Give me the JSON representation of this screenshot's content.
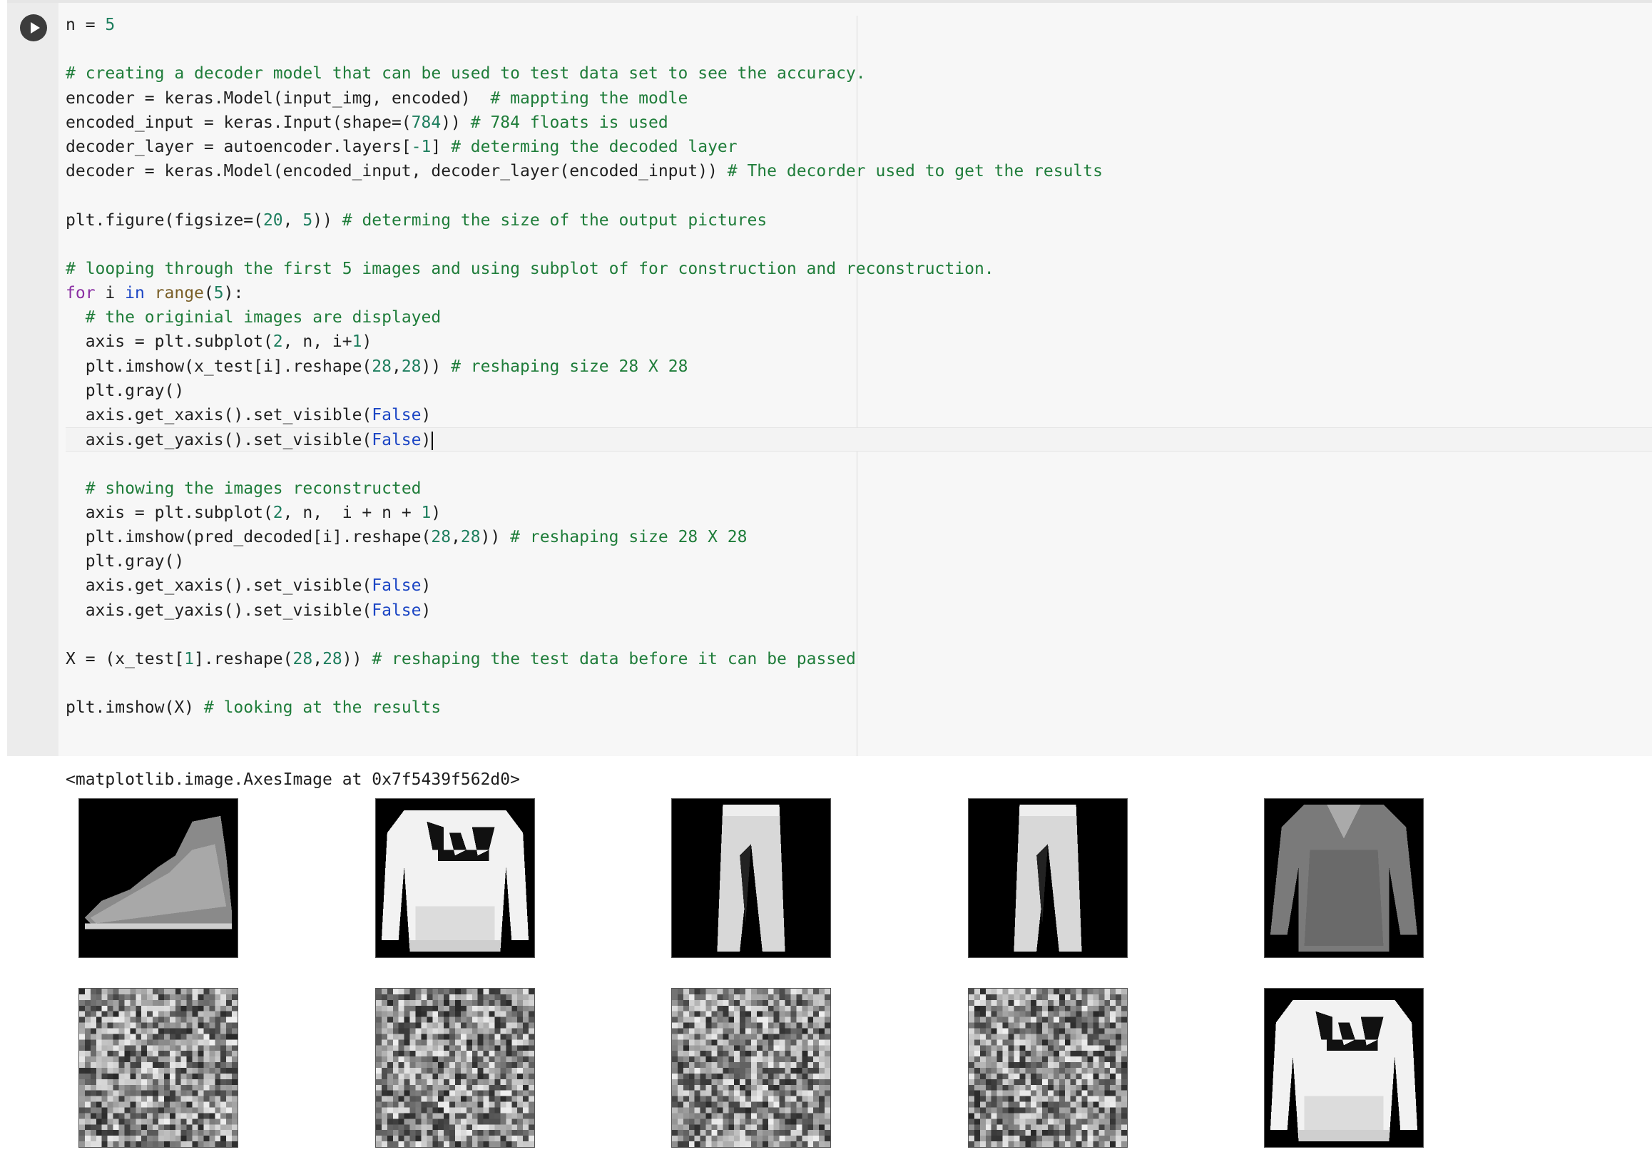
{
  "cell": {
    "run_button_label": "Run cell",
    "lines": [
      [
        [
          "n = ",
          ""
        ],
        [
          "5",
          "t-num"
        ]
      ],
      [],
      [
        [
          "# creating a decoder model that can be used to test data set to see the accuracy.",
          "t-com"
        ]
      ],
      [
        [
          "encoder = keras.Model(input_img, encoded)  ",
          ""
        ],
        [
          "# mappting the modle",
          "t-com"
        ]
      ],
      [
        [
          "encoded_input = keras.Input(shape=(",
          ""
        ],
        [
          "784",
          "t-num"
        ],
        [
          ")) ",
          ""
        ],
        [
          "# 784 floats is used",
          "t-com"
        ]
      ],
      [
        [
          "decoder_layer = autoencoder.layers[",
          ""
        ],
        [
          "-1",
          "t-num"
        ],
        [
          "] ",
          ""
        ],
        [
          "# determing the decoded layer",
          "t-com"
        ]
      ],
      [
        [
          "decoder = keras.Model(encoded_input, decoder_layer(encoded_input)) ",
          ""
        ],
        [
          "# The decorder used to get the results",
          "t-com"
        ]
      ],
      [],
      [
        [
          "plt.figure(figsize=(",
          ""
        ],
        [
          "20",
          "t-num"
        ],
        [
          ", ",
          ""
        ],
        [
          "5",
          "t-num"
        ],
        [
          ")) ",
          ""
        ],
        [
          "# determing the size of the output pictures",
          "t-com"
        ]
      ],
      [],
      [
        [
          "# looping through the first 5 images and using subplot of for construction and reconstruction.",
          "t-com"
        ]
      ],
      [
        [
          "for",
          "t-kw"
        ],
        [
          " i ",
          ""
        ],
        [
          "in",
          "t-kw2"
        ],
        [
          " ",
          ""
        ],
        [
          "range",
          "t-bi"
        ],
        [
          "(",
          ""
        ],
        [
          "5",
          "t-num"
        ],
        [
          "):",
          ""
        ]
      ],
      [
        [
          "  ",
          ""
        ],
        [
          "# the originial images are displayed",
          "t-com"
        ]
      ],
      [
        [
          "  axis = plt.subplot(",
          ""
        ],
        [
          "2",
          "t-num"
        ],
        [
          ", n, i+",
          ""
        ],
        [
          "1",
          "t-num"
        ],
        [
          ")",
          ""
        ]
      ],
      [
        [
          "  plt.imshow(x_test[i].reshape(",
          ""
        ],
        [
          "28",
          "t-num"
        ],
        [
          ",",
          ""
        ],
        [
          "28",
          "t-num"
        ],
        [
          ")) ",
          ""
        ],
        [
          "# reshaping size 28 X 28",
          "t-com"
        ]
      ],
      [
        [
          "  plt.gray()",
          ""
        ]
      ],
      [
        [
          "  axis.get_xaxis().set_visible(",
          ""
        ],
        [
          "False",
          "t-const"
        ],
        [
          ")",
          ""
        ]
      ],
      [
        [
          "  axis.get_yaxis().set_visible(",
          ""
        ],
        [
          "False",
          "t-const"
        ],
        [
          ")",
          ""
        ]
      ],
      [],
      [
        [
          "  ",
          ""
        ],
        [
          "# showing the images reconstructed",
          "t-com"
        ]
      ],
      [
        [
          "  axis = plt.subplot(",
          ""
        ],
        [
          "2",
          "t-num"
        ],
        [
          ", n,  i + n + ",
          ""
        ],
        [
          "1",
          "t-num"
        ],
        [
          ")",
          ""
        ]
      ],
      [
        [
          "  plt.imshow(pred_decoded[i].reshape(",
          ""
        ],
        [
          "28",
          "t-num"
        ],
        [
          ",",
          ""
        ],
        [
          "28",
          "t-num"
        ],
        [
          ")) ",
          ""
        ],
        [
          "# reshaping size 28 X 28",
          "t-com"
        ]
      ],
      [
        [
          "  plt.gray()",
          ""
        ]
      ],
      [
        [
          "  axis.get_xaxis().set_visible(",
          ""
        ],
        [
          "False",
          "t-const"
        ],
        [
          ")",
          ""
        ]
      ],
      [
        [
          "  axis.get_yaxis().set_visible(",
          ""
        ],
        [
          "False",
          "t-const"
        ],
        [
          ")",
          ""
        ]
      ],
      [],
      [
        [
          "X = (x_test[",
          ""
        ],
        [
          "1",
          "t-num"
        ],
        [
          "].reshape(",
          ""
        ],
        [
          "28",
          "t-num"
        ],
        [
          ",",
          ""
        ],
        [
          "28",
          "t-num"
        ],
        [
          ")) ",
          ""
        ],
        [
          "# reshaping the test data before it can be passed",
          "t-com"
        ]
      ],
      [],
      [
        [
          "plt.imshow(X) ",
          ""
        ],
        [
          "# looking at the results",
          "t-com"
        ]
      ]
    ],
    "active_line": 17
  },
  "output": {
    "repr_text": "<matplotlib.image.AxesImage at 0x7f5439f562d0>",
    "top_row": [
      "ankle-boot",
      "lee-sweater",
      "trousers",
      "trousers",
      "shirt"
    ],
    "bottom_row": [
      "noise",
      "noise",
      "noise",
      "noise",
      "lee-sweater"
    ]
  }
}
